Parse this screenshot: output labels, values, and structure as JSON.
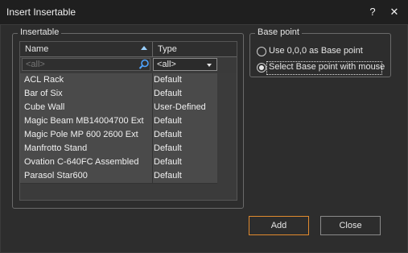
{
  "window": {
    "title": "Insert Insertable",
    "help_glyph": "?",
    "close_glyph": "✕"
  },
  "insertable_group": {
    "label": "Insertable",
    "columns": {
      "name": "Name",
      "type": "Type"
    },
    "filter": {
      "name_placeholder": "<all>",
      "type_value": "<all>"
    },
    "rows": [
      {
        "name": "ACL Rack",
        "type": "Default"
      },
      {
        "name": "Bar of Six",
        "type": "Default"
      },
      {
        "name": "Cube Wall",
        "type": "User-Defined"
      },
      {
        "name": "Magic Beam MB14004700 Ext",
        "type": "Default"
      },
      {
        "name": "Magic Pole MP 600 2600 Ext",
        "type": "Default"
      },
      {
        "name": "Manfrotto Stand",
        "type": "Default"
      },
      {
        "name": "Ovation C-640FC Assembled",
        "type": "Default"
      },
      {
        "name": "Parasol Star600",
        "type": "Default"
      }
    ]
  },
  "base_point_group": {
    "label": "Base point",
    "options": [
      {
        "label": "Use 0,0,0 as Base point",
        "checked": false
      },
      {
        "label": "Select Base point with mouse",
        "checked": true
      }
    ]
  },
  "buttons": {
    "add": "Add",
    "close": "Close"
  }
}
